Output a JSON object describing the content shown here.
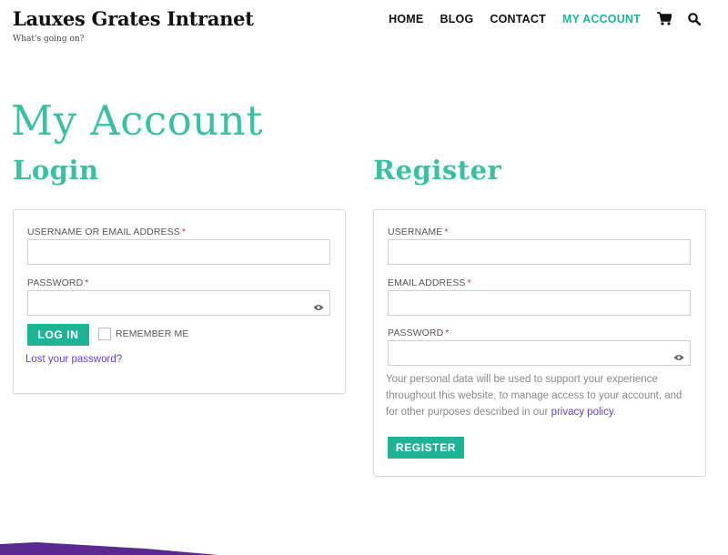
{
  "site": {
    "title": "Lauxes Grates Intranet",
    "tagline": "What's going on?"
  },
  "nav": {
    "items": [
      "HOME",
      "BLOG",
      "CONTACT",
      "MY ACCOUNT"
    ],
    "active": "MY ACCOUNT",
    "icons": [
      "cart-icon",
      "search-icon"
    ]
  },
  "page": {
    "title": "My Account"
  },
  "login": {
    "heading": "Login",
    "username_label": "USERNAME OR EMAIL ADDRESS",
    "username_value": "",
    "password_label": "PASSWORD",
    "password_value": "",
    "required_mark": "*",
    "button": "LOG IN",
    "remember_label": "REMEMBER ME",
    "remember_checked": false,
    "lost_password": "Lost your password?"
  },
  "register": {
    "heading": "Register",
    "username_label": "USERNAME",
    "username_value": "",
    "email_label": "EMAIL ADDRESS",
    "email_value": "",
    "password_label": "PASSWORD",
    "password_value": "",
    "required_mark": "*",
    "privacy_text": "Your personal data will be used to support your experience throughout this website, to manage access to your account, and for other purposes described in our",
    "privacy_link": "privacy policy",
    "privacy_end": ".",
    "button": "REGISTER"
  },
  "colors": {
    "accent": "#20b497",
    "heading": "#3cc0a3",
    "link": "#6a3fc4",
    "required": "#c0392b"
  }
}
